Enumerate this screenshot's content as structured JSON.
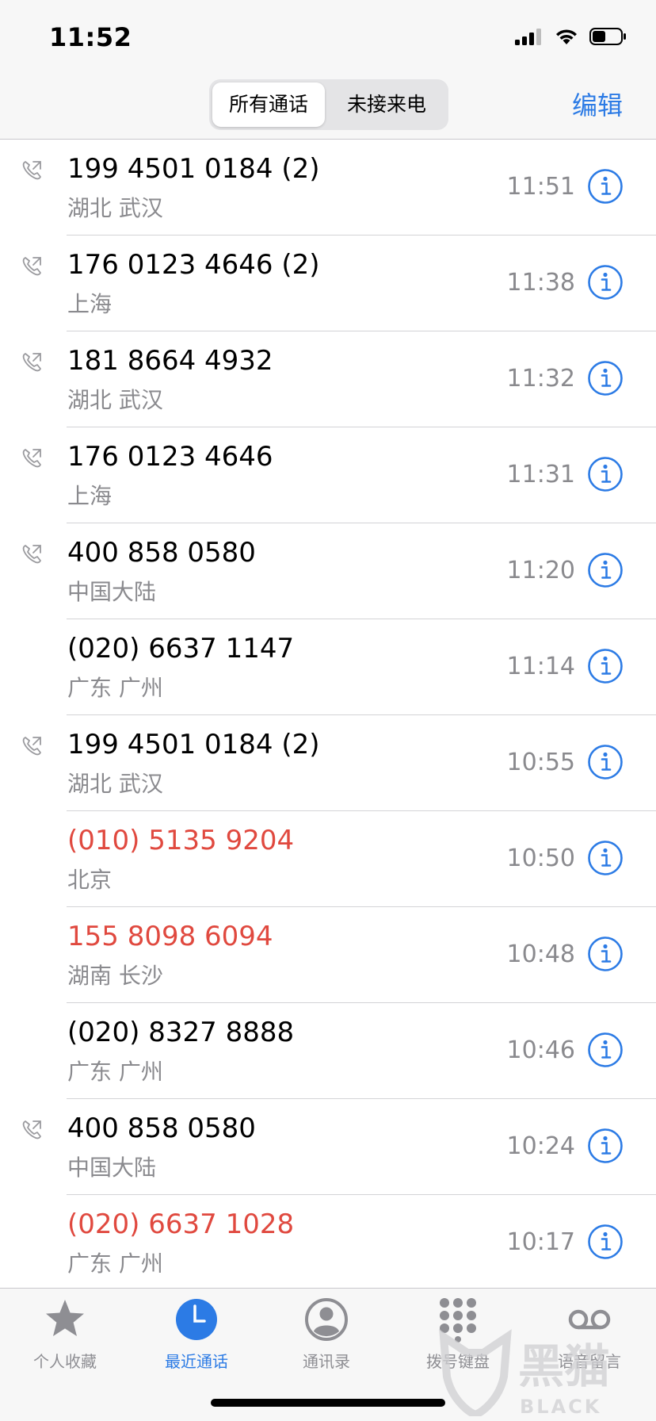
{
  "status": {
    "time": "11:52"
  },
  "header": {
    "segments": [
      "所有通话",
      "未接来电"
    ],
    "selected_segment": 0,
    "edit_label": "编辑"
  },
  "calls": [
    {
      "number": "199 4501 0184 (2)",
      "location": "湖北 武汉",
      "time": "11:51",
      "outgoing": true,
      "missed": false
    },
    {
      "number": "176 0123 4646 (2)",
      "location": "上海",
      "time": "11:38",
      "outgoing": true,
      "missed": false
    },
    {
      "number": "181 8664 4932",
      "location": "湖北 武汉",
      "time": "11:32",
      "outgoing": true,
      "missed": false
    },
    {
      "number": "176 0123 4646",
      "location": "上海",
      "time": "11:31",
      "outgoing": true,
      "missed": false
    },
    {
      "number": "400 858 0580",
      "location": "中国大陆",
      "time": "11:20",
      "outgoing": true,
      "missed": false
    },
    {
      "number": "(020) 6637 1147",
      "location": "广东 广州",
      "time": "11:14",
      "outgoing": false,
      "missed": false
    },
    {
      "number": "199 4501 0184 (2)",
      "location": "湖北 武汉",
      "time": "10:55",
      "outgoing": true,
      "missed": false
    },
    {
      "number": "(010) 5135 9204",
      "location": "北京",
      "time": "10:50",
      "outgoing": false,
      "missed": true
    },
    {
      "number": "155 8098 6094",
      "location": "湖南 长沙",
      "time": "10:48",
      "outgoing": false,
      "missed": true
    },
    {
      "number": "(020) 8327 8888",
      "location": "广东 广州",
      "time": "10:46",
      "outgoing": false,
      "missed": false
    },
    {
      "number": "400 858 0580",
      "location": "中国大陆",
      "time": "10:24",
      "outgoing": true,
      "missed": false
    },
    {
      "number": "(020) 6637 1028",
      "location": "广东 广州",
      "time": "10:17",
      "outgoing": false,
      "missed": true
    }
  ],
  "tabbar": {
    "items": [
      {
        "label": "个人收藏",
        "icon": "star-icon",
        "active": false
      },
      {
        "label": "最近通话",
        "icon": "clock-icon",
        "active": true
      },
      {
        "label": "通讯录",
        "icon": "contact-icon",
        "active": false
      },
      {
        "label": "拨号键盘",
        "icon": "keypad-icon",
        "active": false
      },
      {
        "label": "语音留言",
        "icon": "voicemail-icon",
        "active": false
      }
    ]
  },
  "watermark": {
    "cn": "黑猫",
    "en": "BLACK CAT"
  },
  "colors": {
    "accent": "#2c7be5",
    "missed": "#e0493f",
    "secondary": "#8a8a8e"
  }
}
